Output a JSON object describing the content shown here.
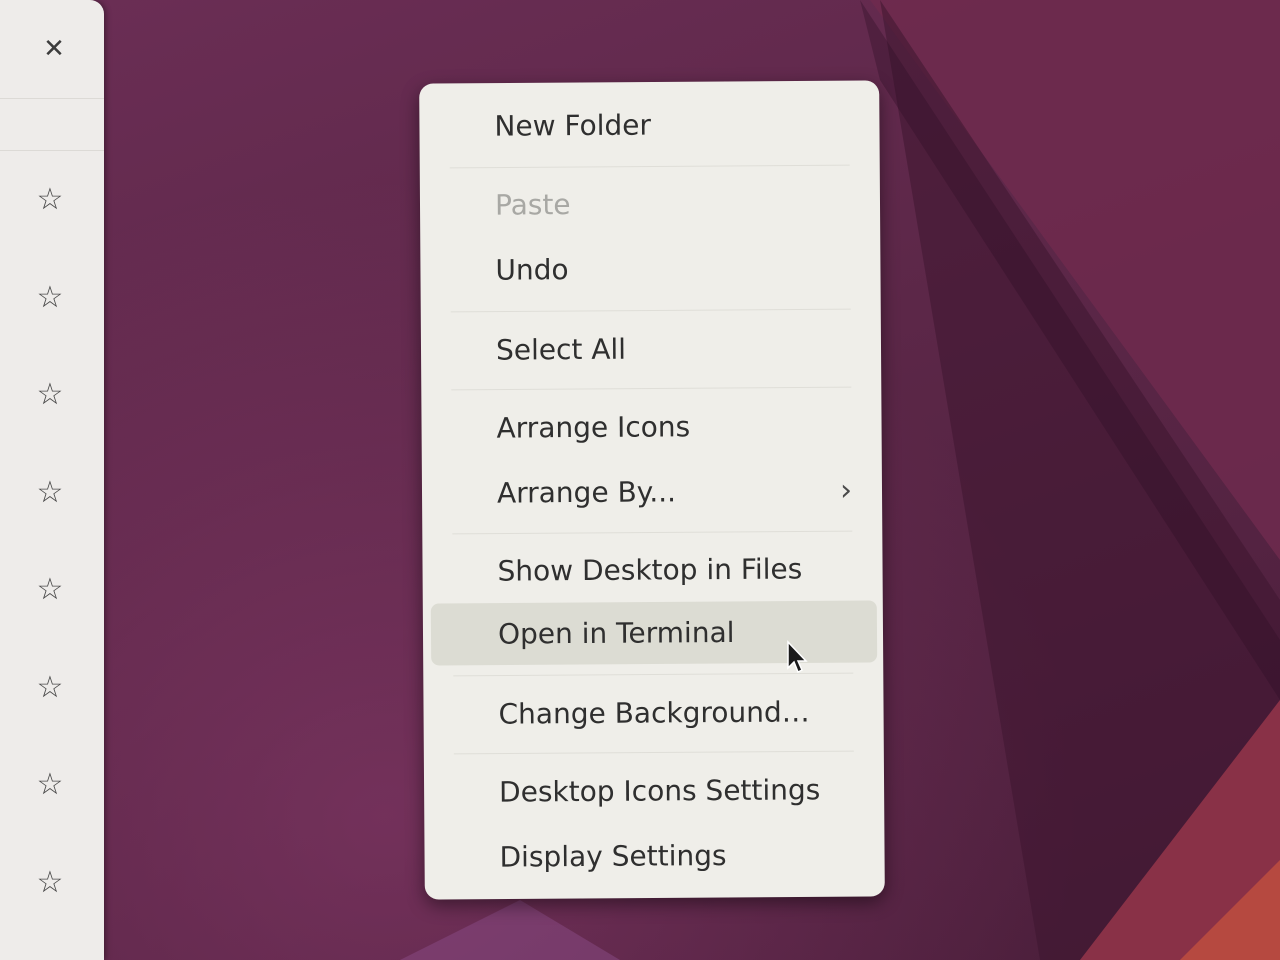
{
  "side_panel": {
    "close_icon_glyph": "✕",
    "star_icon_glyph": "☆",
    "star_count": 8
  },
  "context_menu": {
    "items": [
      {
        "label": "New Folder",
        "enabled": true
      },
      {
        "label": "Paste",
        "enabled": false
      },
      {
        "label": "Undo",
        "enabled": true
      },
      {
        "label": "Select All",
        "enabled": true
      },
      {
        "label": "Arrange Icons",
        "enabled": true
      },
      {
        "label": "Arrange By...",
        "enabled": true,
        "submenu": true
      },
      {
        "label": "Show Desktop in Files",
        "enabled": true
      },
      {
        "label": "Open in Terminal",
        "enabled": true,
        "highlighted": true
      },
      {
        "label": "Change Background…",
        "enabled": true
      },
      {
        "label": "Desktop Icons Settings",
        "enabled": true
      },
      {
        "label": "Display Settings",
        "enabled": true
      }
    ],
    "submenu_chevron_glyph": "›"
  },
  "colors": {
    "wallpaper": "#5a2747",
    "menu_background": "#efeee9",
    "menu_highlight": "#dcdcd3",
    "text": "#2f2f2f",
    "disabled_text": "#a8a8a4"
  }
}
